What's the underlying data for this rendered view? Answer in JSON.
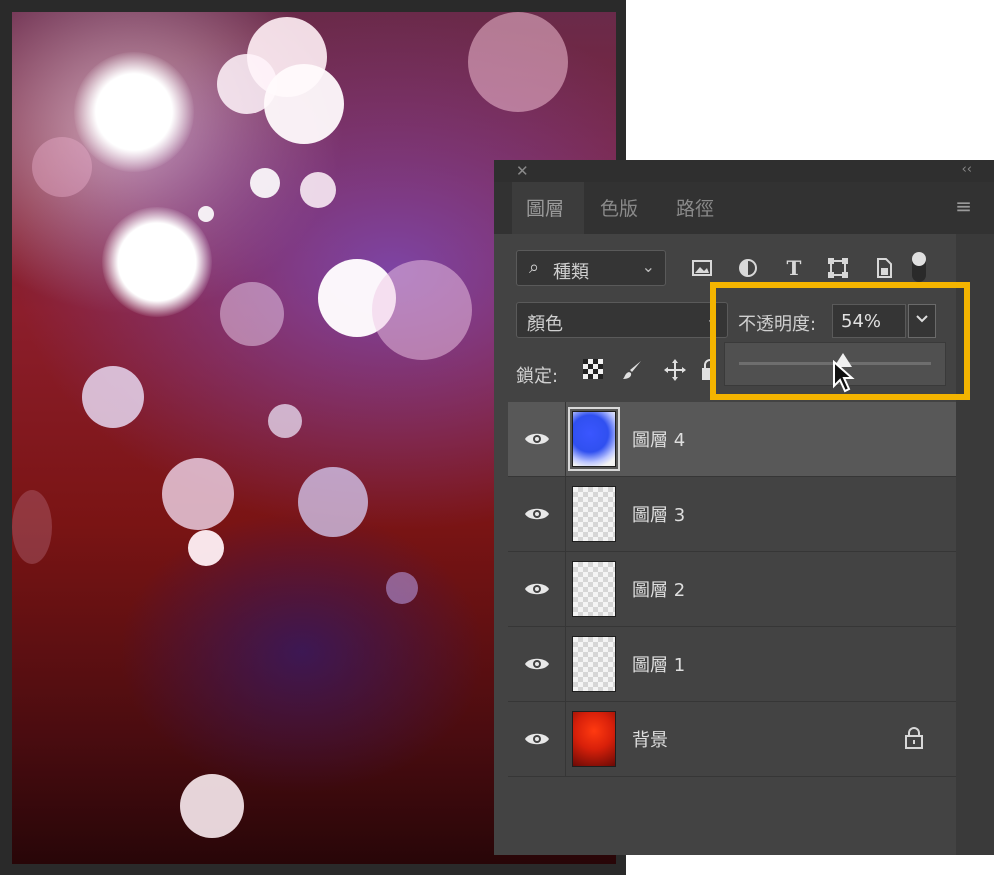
{
  "panel": {
    "close": "✕",
    "collapse": "‹‹",
    "tabs": [
      {
        "label": "圖層",
        "active": true
      },
      {
        "label": "色版",
        "active": false
      },
      {
        "label": "路徑",
        "active": false
      }
    ],
    "menu_icon": "hamburger-menu-icon"
  },
  "filter": {
    "kind_label": "種類",
    "icons": [
      "image-filter-icon",
      "adjustment-filter-icon",
      "type-filter-icon",
      "shape-filter-icon",
      "smart-object-filter-icon"
    ]
  },
  "blend": {
    "mode": "顏色",
    "opacity_label": "不透明度:",
    "opacity_value": "54%",
    "opacity_slider_fraction": 0.54
  },
  "lock": {
    "label": "鎖定:",
    "icons": [
      "lock-transparent-pixels-icon",
      "lock-image-pixels-icon",
      "lock-position-icon",
      "lock-artboard-icon"
    ]
  },
  "layers": [
    {
      "name": "圖層 4",
      "selected": true,
      "thumb": "blue",
      "locked": false
    },
    {
      "name": "圖層 3",
      "selected": false,
      "thumb": "transparent",
      "locked": false
    },
    {
      "name": "圖層 2",
      "selected": false,
      "thumb": "transparent",
      "locked": false
    },
    {
      "name": "圖層 1",
      "selected": false,
      "thumb": "transparent",
      "locked": false
    },
    {
      "name": "背景",
      "selected": false,
      "thumb": "red",
      "locked": true
    }
  ],
  "colors": {
    "highlight": "#f4b400",
    "panel_bg": "#434343",
    "selected_row": "#585858"
  }
}
